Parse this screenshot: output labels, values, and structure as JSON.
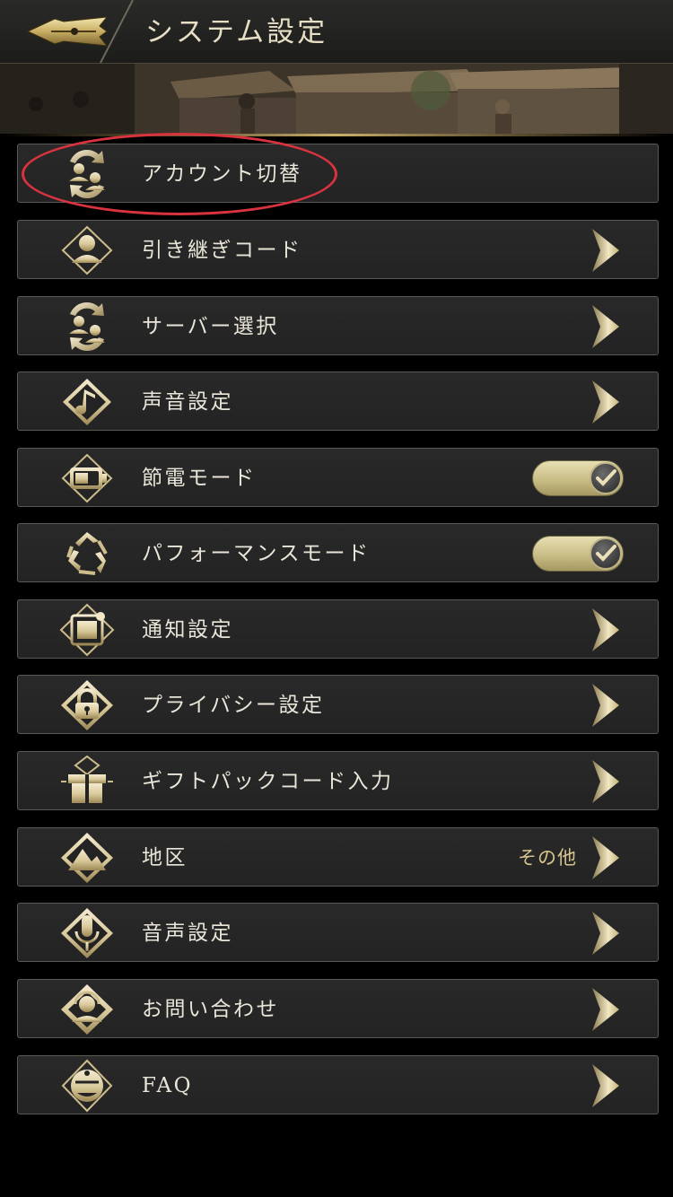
{
  "header": {
    "title": "システム設定",
    "back_icon": "back-brush-icon"
  },
  "banner": {
    "description_icon": "town-scene-banner"
  },
  "colors": {
    "gold": "#d6c58e",
    "row_bg": "#262626",
    "row_border": "#5a5a55",
    "highlight": "#d8333f"
  },
  "menu": [
    {
      "label": "アカウント切替",
      "icon": "account-switch-icon",
      "control": "none",
      "highlighted": true
    },
    {
      "label": "引き継ぎコード",
      "icon": "user-icon",
      "control": "chevron"
    },
    {
      "label": "サーバー選択",
      "icon": "server-select-icon",
      "control": "chevron"
    },
    {
      "label": "声音設定",
      "icon": "music-note-icon",
      "control": "chevron"
    },
    {
      "label": "節電モード",
      "icon": "battery-icon",
      "control": "toggle",
      "on": true
    },
    {
      "label": "パフォーマンスモード",
      "icon": "performance-icon",
      "control": "toggle",
      "on": true
    },
    {
      "label": "通知設定",
      "icon": "notification-icon",
      "control": "chevron"
    },
    {
      "label": "プライバシー設定",
      "icon": "lock-icon",
      "control": "chevron"
    },
    {
      "label": "ギフトパックコード入力",
      "icon": "gift-icon",
      "control": "chevron"
    },
    {
      "label": "地区",
      "icon": "region-icon",
      "control": "chevron",
      "value": "その他"
    },
    {
      "label": "音声設定",
      "icon": "microphone-icon",
      "control": "chevron"
    },
    {
      "label": "お問い合わせ",
      "icon": "support-icon",
      "control": "chevron"
    },
    {
      "label": "FAQ",
      "icon": "faq-icon",
      "control": "chevron"
    }
  ]
}
